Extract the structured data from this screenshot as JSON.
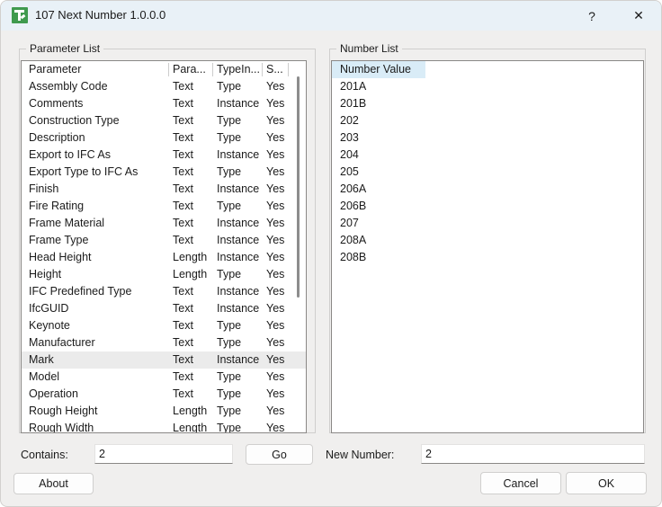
{
  "window": {
    "title": "107 Next Number 1.0.0.0",
    "icon": "app-icon",
    "help_label": "?",
    "close_label": "✕"
  },
  "parameter_group": {
    "legend": "Parameter List",
    "columns": [
      "Parameter",
      "Para...",
      "TypeIn...",
      "S..."
    ],
    "selected_row": "Mark",
    "rows": [
      {
        "parameter": "Assembly Code",
        "type": "Text",
        "typein": "Type",
        "shared": "Yes"
      },
      {
        "parameter": "Comments",
        "type": "Text",
        "typein": "Instance",
        "shared": "Yes"
      },
      {
        "parameter": "Construction Type",
        "type": "Text",
        "typein": "Type",
        "shared": "Yes"
      },
      {
        "parameter": "Description",
        "type": "Text",
        "typein": "Type",
        "shared": "Yes"
      },
      {
        "parameter": "Export to IFC As",
        "type": "Text",
        "typein": "Instance",
        "shared": "Yes"
      },
      {
        "parameter": "Export Type to IFC As",
        "type": "Text",
        "typein": "Type",
        "shared": "Yes"
      },
      {
        "parameter": "Finish",
        "type": "Text",
        "typein": "Instance",
        "shared": "Yes"
      },
      {
        "parameter": "Fire Rating",
        "type": "Text",
        "typein": "Type",
        "shared": "Yes"
      },
      {
        "parameter": "Frame Material",
        "type": "Text",
        "typein": "Instance",
        "shared": "Yes"
      },
      {
        "parameter": "Frame Type",
        "type": "Text",
        "typein": "Instance",
        "shared": "Yes"
      },
      {
        "parameter": "Head Height",
        "type": "Length",
        "typein": "Instance",
        "shared": "Yes"
      },
      {
        "parameter": "Height",
        "type": "Length",
        "typein": "Type",
        "shared": "Yes"
      },
      {
        "parameter": "IFC Predefined Type",
        "type": "Text",
        "typein": "Instance",
        "shared": "Yes"
      },
      {
        "parameter": "IfcGUID",
        "type": "Text",
        "typein": "Instance",
        "shared": "Yes"
      },
      {
        "parameter": "Keynote",
        "type": "Text",
        "typein": "Type",
        "shared": "Yes"
      },
      {
        "parameter": "Manufacturer",
        "type": "Text",
        "typein": "Type",
        "shared": "Yes"
      },
      {
        "parameter": "Mark",
        "type": "Text",
        "typein": "Instance",
        "shared": "Yes"
      },
      {
        "parameter": "Model",
        "type": "Text",
        "typein": "Type",
        "shared": "Yes"
      },
      {
        "parameter": "Operation",
        "type": "Text",
        "typein": "Type",
        "shared": "Yes"
      },
      {
        "parameter": "Rough Height",
        "type": "Length",
        "typein": "Type",
        "shared": "Yes"
      },
      {
        "parameter": "Rough Width",
        "type": "Length",
        "typein": "Type",
        "shared": "Yes"
      }
    ]
  },
  "number_group": {
    "legend": "Number List",
    "column_header": "Number Value",
    "values": [
      "201A",
      "201B",
      "202",
      "203",
      "204",
      "205",
      "206A",
      "206B",
      "207",
      "208A",
      "208B"
    ]
  },
  "footer": {
    "contains_label": "Contains:",
    "contains_value": "2",
    "go_label": "Go",
    "new_number_label": "New Number:",
    "new_number_value": "2",
    "about_label": "About",
    "cancel_label": "Cancel",
    "ok_label": "OK"
  }
}
